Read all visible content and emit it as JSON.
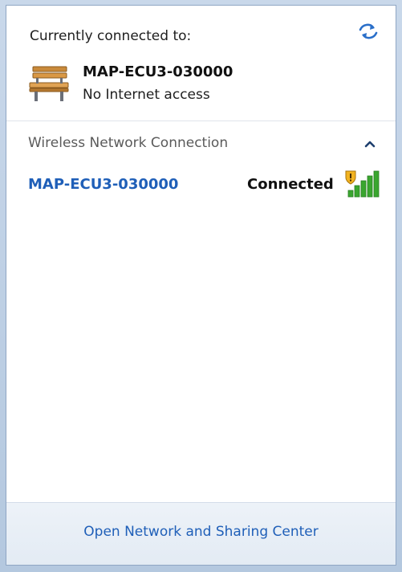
{
  "current": {
    "heading": "Currently connected to:",
    "network_name": "MAP-ECU3-030000",
    "network_status": "No Internet access",
    "icon": "park-bench-icon"
  },
  "wireless": {
    "section_title": "Wireless Network Connection",
    "collapse_icon": "chevron-up-icon",
    "networks": [
      {
        "name": "MAP-ECU3-030000",
        "state": "Connected",
        "icon": "wifi-signal-warning-icon"
      }
    ]
  },
  "footer": {
    "link_label": "Open Network and Sharing Center"
  },
  "colors": {
    "link": "#1f5fb8",
    "signal": "#3aa62f",
    "warning": "#f2b320"
  }
}
